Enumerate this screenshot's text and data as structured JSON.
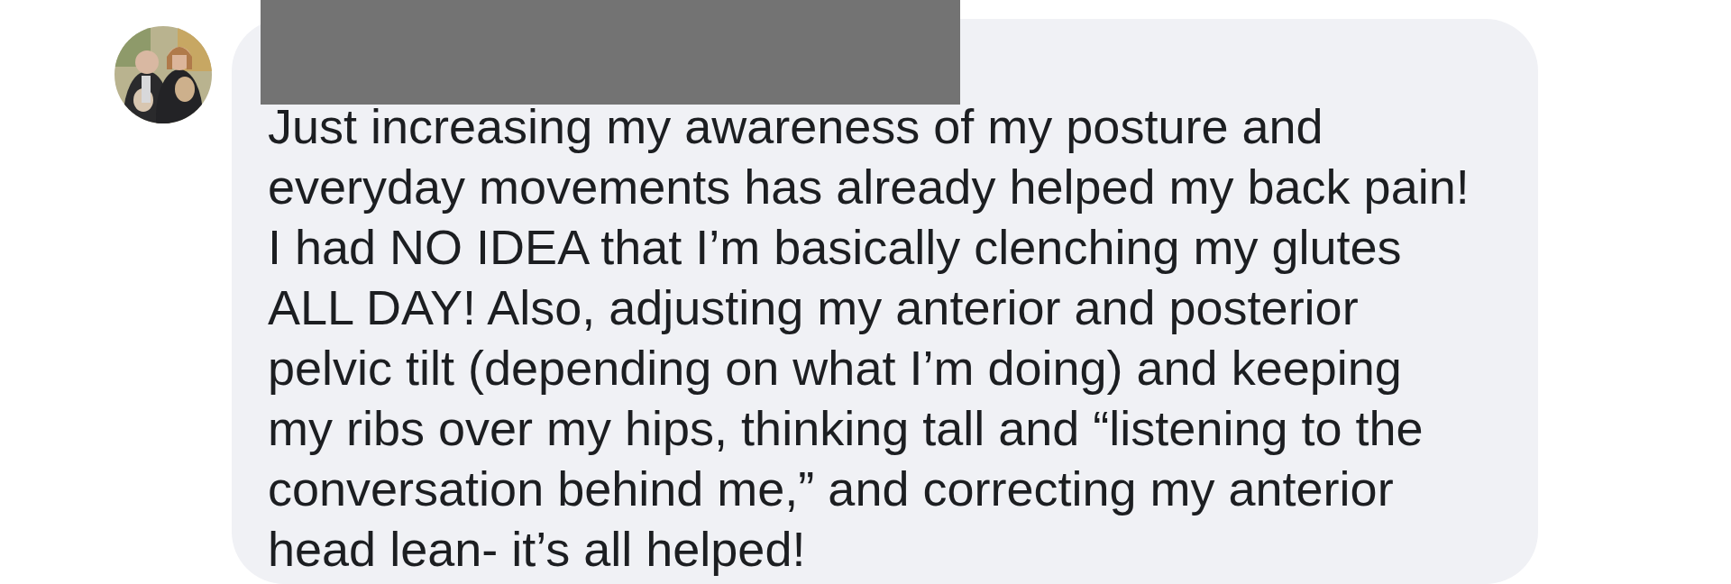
{
  "comment": {
    "text": "Just increasing my awareness of my posture and\neveryday movements has already helped my back pain!\nI had NO IDEA that I’m basically clenching my glutes\nALL DAY! Also, adjusting my anterior and posterior\npelvic tilt (depending on what I’m doing) and keeping\nmy ribs over my hips, thinking tall and “listening to the\nconversation behind me,” and correcting my anterior\nhead lean- it’s all helped!"
  }
}
